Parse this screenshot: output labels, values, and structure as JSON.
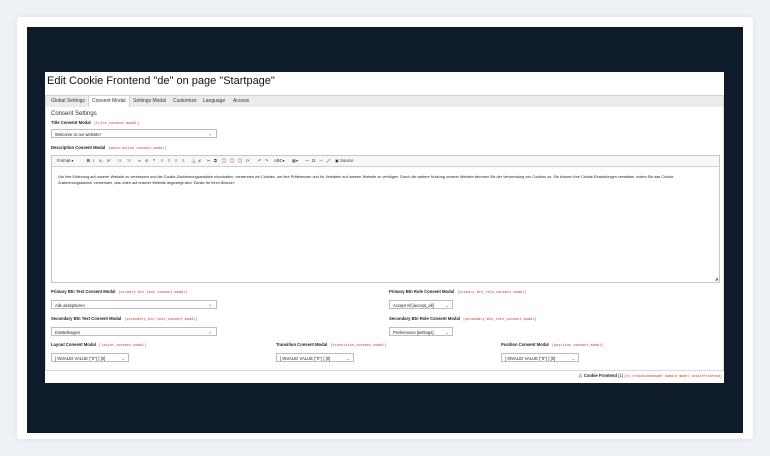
{
  "page": {
    "title": "Edit Cookie Frontend \"de\" on page \"Startpage\""
  },
  "tabs": [
    {
      "label": "Global Settings"
    },
    {
      "label": "Consent Modal"
    },
    {
      "label": "Settings Modal"
    },
    {
      "label": "Customize"
    },
    {
      "label": "Language"
    },
    {
      "label": "Access"
    }
  ],
  "form": {
    "section_title": "Consent Settings",
    "title_label": "Title Consent Modal",
    "title_code": "[title_consent_modal]",
    "title_value": "Welcome to our website!",
    "description_label": "Description Consent Modal",
    "description_code": "[description_consent_modal]",
    "description_value": "Um Ihre Erfahrung auf unserer Website zu verbessern und die Cookie-Zustimmungsansätze einzuhalten, verwenden wir Cookies, um Ihre Präferenzen und Ihr Verhalten auf unserer Website zu verfolgen. Durch die weitere Nutzung unserer Website stimmen Sie der Verwendung von Cookies zu. Sie können Ihre Cookie-Einstellungen verwalten, indem Sie das Cookie-Zustimmungsbanner verwenden, das unten auf unserer Website angezeigt wird. Danke für Ihren Besuch!",
    "primary_text_label": "Primary Btn Text Consent Modal",
    "primary_text_code": "[primary_btn_text_consent_modal]",
    "primary_text_value": "Alle akzeptieren",
    "primary_role_label": "Primary Btn Role Consent Modal",
    "primary_role_code": "[primary_btn_role_consent_modal]",
    "primary_role_value": "Accept All [accept_all]",
    "secondary_text_label": "Secondary Btn Text Consent Modal",
    "secondary_text_code": "[secondary_btn_text_consent_modal]",
    "secondary_text_value": "Einstellungen",
    "secondary_role_label": "Secondary Btn Role Consent Modal",
    "secondary_role_code": "[secondary_btn_role_consent_modal]",
    "secondary_role_value": "Preferences [settings]",
    "layout_label": "Layout Consent Modal",
    "layout_code": "[layout_consent_modal]",
    "layout_value": "[ INVALID VALUE (\"0\") ] [0]",
    "transition_label": "Transition Consent Modal",
    "transition_code": "[transition_consent_modal]",
    "transition_value": "[ INVALID VALUE (\"0\") ] [0]",
    "position_label": "Position Consent Modal",
    "position_code": "[position_consent_modal]",
    "position_value": "[ INVALID VALUE (\"0\") ] [0]"
  },
  "toolbar": {
    "format": "Format",
    "bold": "B",
    "italic": "I",
    "subscript": "x₂",
    "superscript": "x²",
    "source": "Source"
  },
  "footer": {
    "label": "Cookie Frontend",
    "uid": "[1]",
    "code": "[tx_cfcookiemanager_domain_model_cookiefrontend]"
  }
}
